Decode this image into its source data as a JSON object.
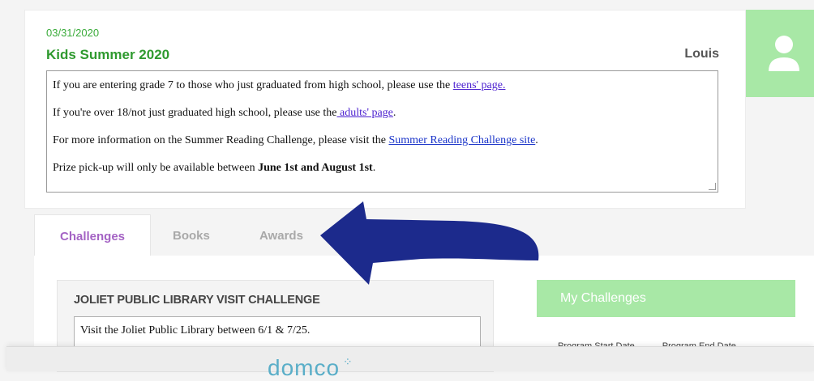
{
  "program": {
    "date": "03/31/2020",
    "title": "Kids Summer 2020",
    "user_name": "Louis"
  },
  "info": {
    "line1_prefix": "If you are entering grade 7 to those who just graduated from high school, please use the ",
    "line1_link": "teens' page.",
    "line2_prefix": "If you're over 18/not just graduated high school, please use the",
    "line2_link": " adults' page",
    "line2_suffix": ".",
    "line3_prefix": "For more information on the Summer Reading Challenge, please visit the ",
    "line3_link": "Summer Reading Challenge site",
    "line3_suffix": ".",
    "line4_prefix": "Prize pick-up will only be available between ",
    "line4_bold": "June 1st and August 1st",
    "line4_suffix": "."
  },
  "tabs": {
    "challenges": "Challenges",
    "books": "Books",
    "awards": "Awards"
  },
  "challenge": {
    "title": "JOLIET PUBLIC LIBRARY VISIT CHALLENGE",
    "description": "Visit the Joliet Public Library between 6/1 & 7/25."
  },
  "my_challenges": {
    "title": "My Challenges",
    "start_label": "Program Start Date",
    "end_label": "Program End Date"
  },
  "footer": {
    "logo_text": "DOMCO"
  },
  "colors": {
    "accent_green": "#2f9a2f",
    "avatar_green": "#a8e8a6",
    "tab_purple": "#a463c4",
    "arrow_navy": "#1c2a8c"
  },
  "icons": {
    "avatar": "user-silhouette-icon",
    "arrow": "curved-arrow-left-icon"
  }
}
